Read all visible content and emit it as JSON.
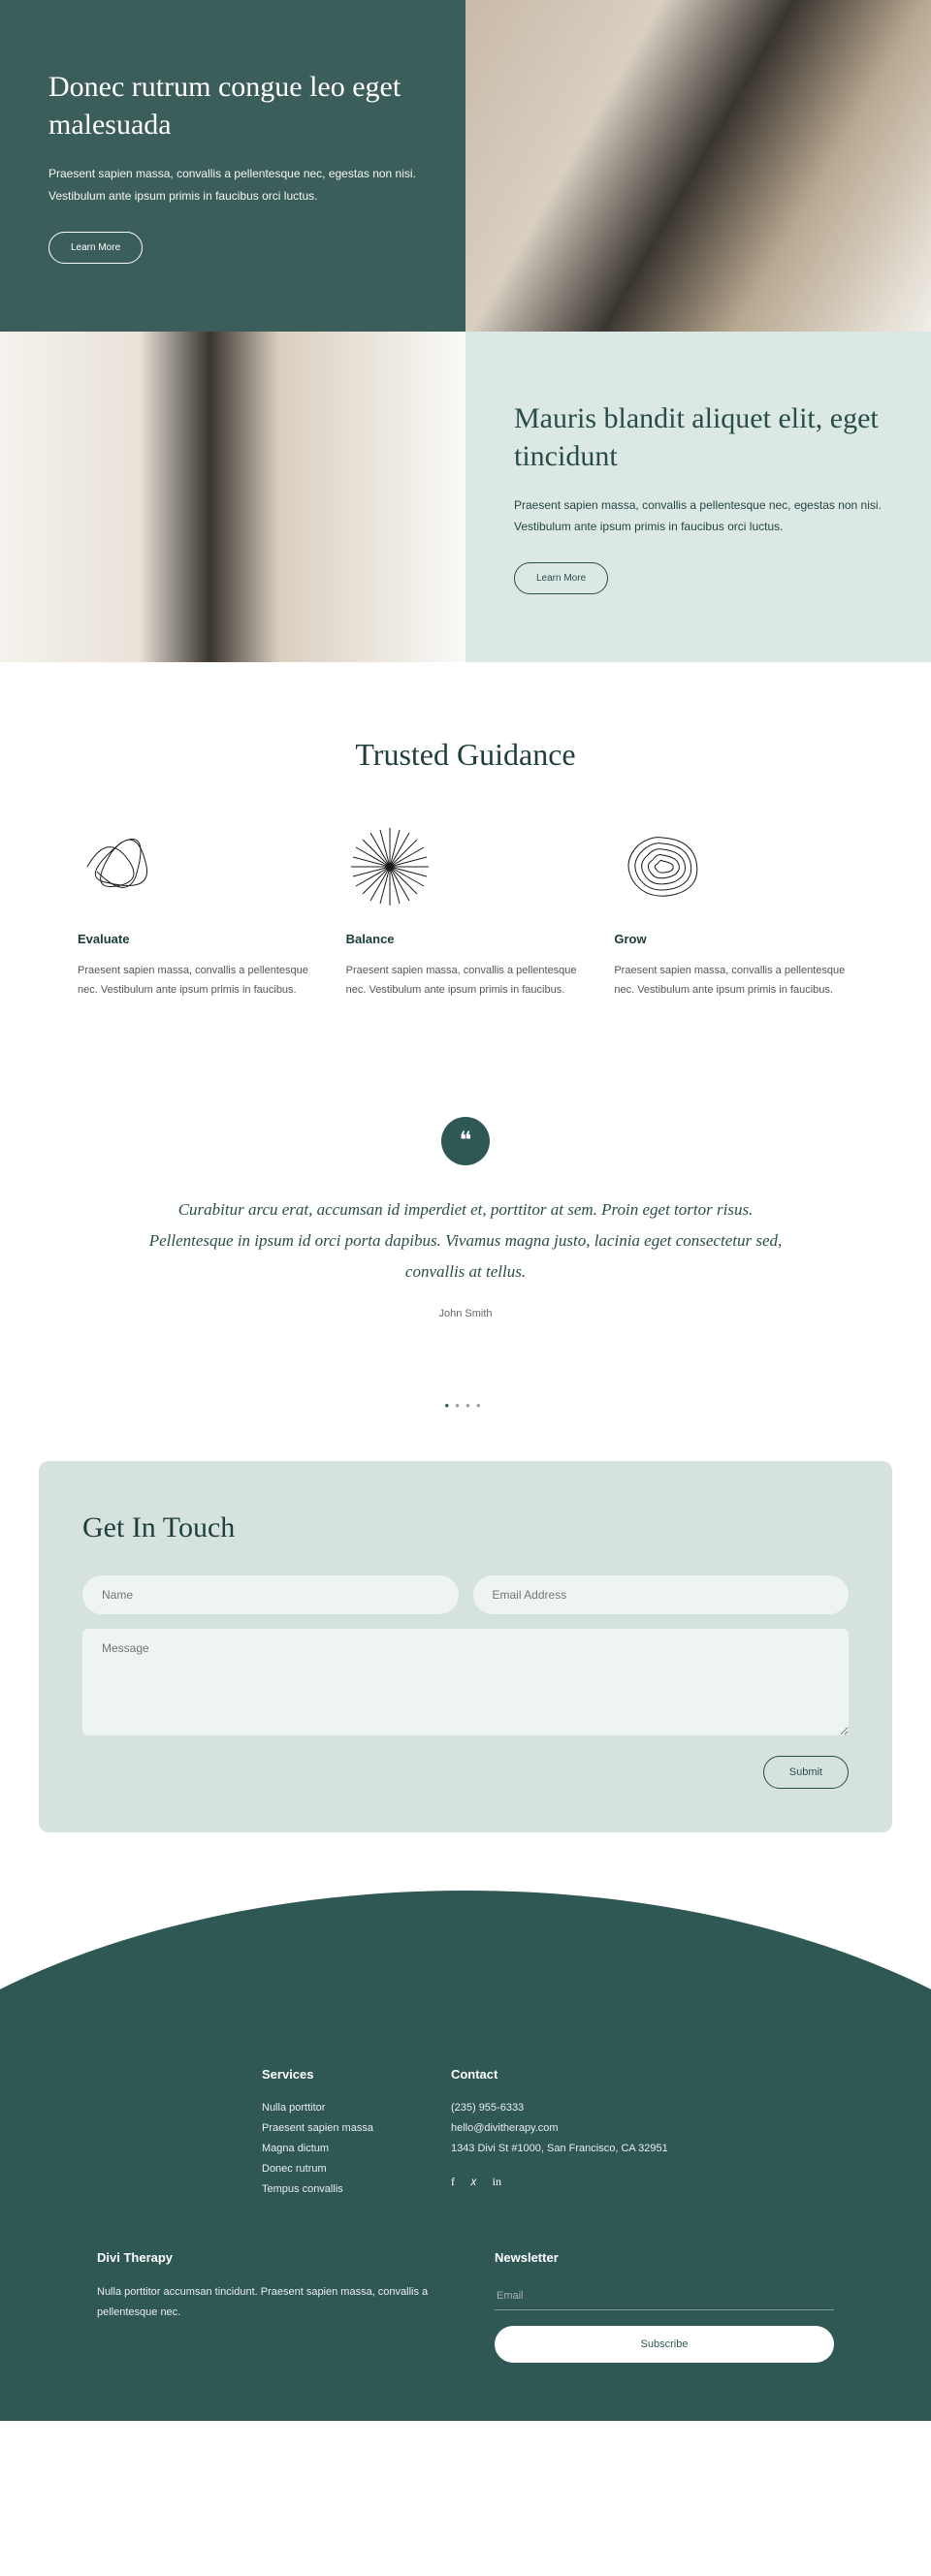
{
  "hero1": {
    "title": "Donec rutrum congue leo eget malesuada",
    "desc": "Praesent sapien massa, convallis a pellentesque nec, egestas non nisi. Vestibulum ante ipsum primis in faucibus orci luctus.",
    "btn": "Learn More"
  },
  "hero2": {
    "title": "Mauris blandit aliquet elit, eget tincidunt",
    "desc": "Praesent sapien massa, convallis a pellentesque nec, egestas non nisi. Vestibulum ante ipsum primis in faucibus orci luctus.",
    "btn": "Learn More"
  },
  "guidance": {
    "title": "Trusted Guidance",
    "items": [
      {
        "title": "Evaluate",
        "desc": "Praesent sapien massa, convallis a pellentesque nec. Vestibulum ante ipsum primis in faucibus."
      },
      {
        "title": "Balance",
        "desc": "Praesent sapien massa, convallis a pellentesque nec. Vestibulum ante ipsum primis in faucibus."
      },
      {
        "title": "Grow",
        "desc": "Praesent sapien massa, convallis a pellentesque nec. Vestibulum ante ipsum primis in faucibus."
      }
    ]
  },
  "testimonial": {
    "quote": "Curabitur arcu erat, accumsan id imperdiet et, porttitor at sem. Proin eget tortor risus. Pellentesque in ipsum id orci porta dapibus. Vivamus magna justo, lacinia eget consectetur sed, convallis at tellus.",
    "author": "John Smith"
  },
  "contact": {
    "title": "Get In Touch",
    "name_ph": "Name",
    "email_ph": "Email Address",
    "msg_ph": "Message",
    "submit": "Submit"
  },
  "footer": {
    "services": {
      "title": "Services",
      "items": [
        "Nulla porttitor",
        "Praesent sapien massa",
        "Magna dictum",
        "Donec rutrum",
        "Tempus convallis"
      ]
    },
    "contact": {
      "title": "Contact",
      "phone": "(235) 955-6333",
      "email": "hello@divitherapy.com",
      "address": "1343 Divi St #1000, San Francisco, CA 32951"
    },
    "brand": {
      "title": "Divi Therapy",
      "desc": "Nulla porttitor accumsan tincidunt. Praesent sapien massa, convallis a pellentesque nec."
    },
    "newsletter": {
      "title": "Newsletter",
      "email_ph": "Email",
      "btn": "Subscribe"
    }
  }
}
